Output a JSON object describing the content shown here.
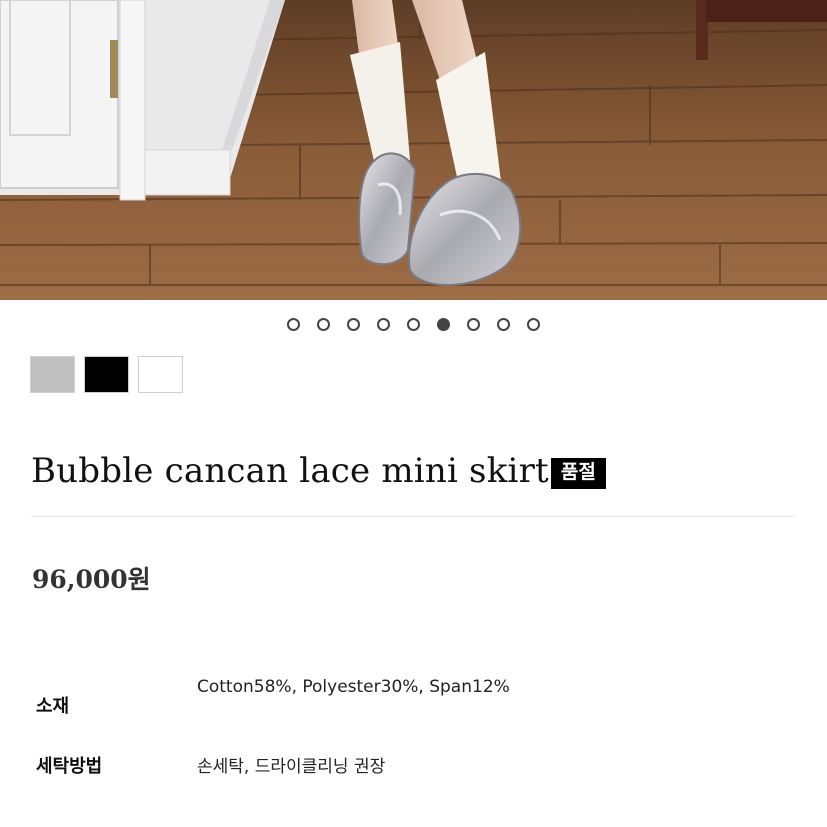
{
  "carousel": {
    "total": 9,
    "active_index": 5
  },
  "swatches": [
    {
      "name": "gray",
      "color": "#c0c0c0"
    },
    {
      "name": "black",
      "color": "#000000"
    },
    {
      "name": "white",
      "color": "#ffffff"
    }
  ],
  "product": {
    "title": "Bubble cancan lace mini skirt",
    "badge": "품절",
    "price": "96,000원"
  },
  "specs": {
    "material_label": "소재",
    "material_value": "Cotton58%, Polyester30%, Span12%",
    "care_label": "세탁방법",
    "care_value": "손세탁, 드라이클리닝 권장"
  },
  "colors": {
    "floor": "#8a5e3a",
    "badge_bg": "#000000",
    "dot_border": "#444444"
  }
}
